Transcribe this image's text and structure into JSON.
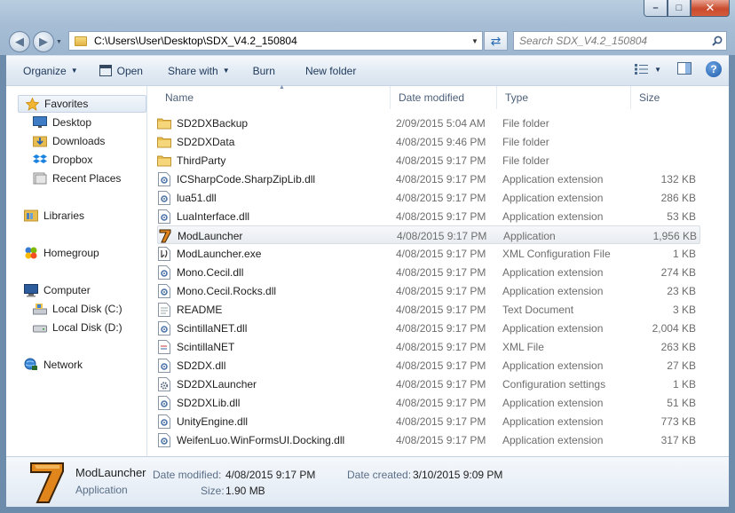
{
  "window": {
    "controls": {
      "minimize": "–",
      "maximize": "□",
      "close": "✕"
    }
  },
  "nav": {
    "back_icon": "arrow-left-icon",
    "forward_icon": "arrow-right-icon",
    "address": "C:\\Users\\User\\Desktop\\SDX_V4.2_150804",
    "search_placeholder": "Search SDX_V4.2_150804"
  },
  "toolbar": {
    "organize": "Organize",
    "open": "Open",
    "share_with": "Share with",
    "burn": "Burn",
    "new_folder": "New folder"
  },
  "navpane": {
    "favorites": "Favorites",
    "desktop": "Desktop",
    "downloads": "Downloads",
    "dropbox": "Dropbox",
    "recent_places": "Recent Places",
    "libraries": "Libraries",
    "homegroup": "Homegroup",
    "computer": "Computer",
    "local_c": "Local Disk (C:)",
    "local_d": "Local Disk (D:)",
    "network": "Network"
  },
  "columns": {
    "name": "Name",
    "date_modified": "Date modified",
    "type": "Type",
    "size": "Size"
  },
  "files": [
    {
      "name": "SD2DXBackup",
      "date": "2/09/2015 5:04 AM",
      "type": "File folder",
      "size": "",
      "icon": "folder-icon"
    },
    {
      "name": "SD2DXData",
      "date": "4/08/2015 9:46 PM",
      "type": "File folder",
      "size": "",
      "icon": "folder-icon"
    },
    {
      "name": "ThirdParty",
      "date": "4/08/2015 9:17 PM",
      "type": "File folder",
      "size": "",
      "icon": "folder-icon"
    },
    {
      "name": "ICSharpCode.SharpZipLib.dll",
      "date": "4/08/2015 9:17 PM",
      "type": "Application extension",
      "size": "132 KB",
      "icon": "dll-icon"
    },
    {
      "name": "lua51.dll",
      "date": "4/08/2015 9:17 PM",
      "type": "Application extension",
      "size": "286 KB",
      "icon": "dll-icon"
    },
    {
      "name": "LuaInterface.dll",
      "date": "4/08/2015 9:17 PM",
      "type": "Application extension",
      "size": "53 KB",
      "icon": "dll-icon"
    },
    {
      "name": "ModLauncher",
      "date": "4/08/2015 9:17 PM",
      "type": "Application",
      "size": "1,956 KB",
      "icon": "modlauncher-app-icon"
    },
    {
      "name": "ModLauncher.exe",
      "date": "4/08/2015 9:17 PM",
      "type": "XML Configuration File",
      "size": "1 KB",
      "icon": "xml-config-icon"
    },
    {
      "name": "Mono.Cecil.dll",
      "date": "4/08/2015 9:17 PM",
      "type": "Application extension",
      "size": "274 KB",
      "icon": "dll-icon"
    },
    {
      "name": "Mono.Cecil.Rocks.dll",
      "date": "4/08/2015 9:17 PM",
      "type": "Application extension",
      "size": "23 KB",
      "icon": "dll-icon"
    },
    {
      "name": "README",
      "date": "4/08/2015 9:17 PM",
      "type": "Text Document",
      "size": "3 KB",
      "icon": "text-document-icon"
    },
    {
      "name": "ScintillaNET.dll",
      "date": "4/08/2015 9:17 PM",
      "type": "Application extension",
      "size": "2,004 KB",
      "icon": "dll-icon"
    },
    {
      "name": "ScintillaNET",
      "date": "4/08/2015 9:17 PM",
      "type": "XML File",
      "size": "263 KB",
      "icon": "xml-file-icon"
    },
    {
      "name": "SD2DX.dll",
      "date": "4/08/2015 9:17 PM",
      "type": "Application extension",
      "size": "27 KB",
      "icon": "dll-icon"
    },
    {
      "name": "SD2DXLauncher",
      "date": "4/08/2015 9:17 PM",
      "type": "Configuration settings",
      "size": "1 KB",
      "icon": "config-settings-icon"
    },
    {
      "name": "SD2DXLib.dll",
      "date": "4/08/2015 9:17 PM",
      "type": "Application extension",
      "size": "51 KB",
      "icon": "dll-icon"
    },
    {
      "name": "UnityEngine.dll",
      "date": "4/08/2015 9:17 PM",
      "type": "Application extension",
      "size": "773 KB",
      "icon": "dll-icon"
    },
    {
      "name": "WeifenLuo.WinFormsUI.Docking.dll",
      "date": "4/08/2015 9:17 PM",
      "type": "Application extension",
      "size": "317 KB",
      "icon": "dll-icon"
    }
  ],
  "details": {
    "name": "ModLauncher",
    "type": "Application",
    "date_modified_label": "Date modified:",
    "date_modified": "4/08/2015 9:17 PM",
    "date_created_label": "Date created:",
    "date_created": "3/10/2015 9:09 PM",
    "size_label": "Size:",
    "size": "1.90 MB",
    "icon": "modlauncher-seven-icon"
  },
  "colors": {
    "accent": "#1c5ba9",
    "folder": "#e8bd4f",
    "selection": "#e8ecf1"
  }
}
